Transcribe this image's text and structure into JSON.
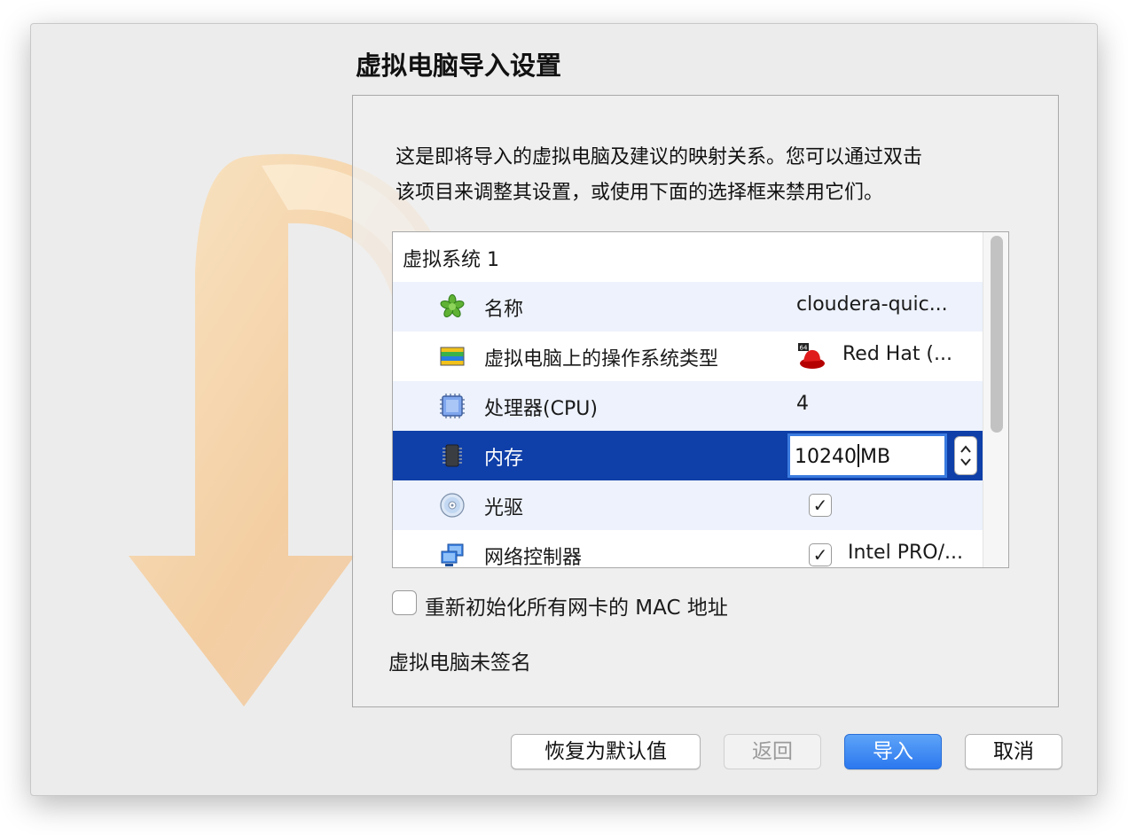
{
  "window": {
    "title": "虚拟电脑导入设置",
    "description_lines": [
      "这是即将导入的虚拟电脑及建议的映射关系。您可以通过双击",
      "该项目来调整其设置，或使用下面的选择框来禁用它们。"
    ]
  },
  "appliance": {
    "group_label": "虚拟系统 1",
    "rows": [
      {
        "icon": "name-asterisk-icon",
        "label": "名称",
        "value": "cloudera-quic..."
      },
      {
        "icon": "os-type-icon",
        "label": "虚拟电脑上的操作系统类型",
        "value": "Red Hat (...",
        "value_icon": "redhat-64-icon",
        "value_icon_text": "64"
      },
      {
        "icon": "cpu-icon",
        "label": "处理器(CPU)",
        "value": "4"
      },
      {
        "icon": "memory-chip-icon",
        "label": "内存",
        "value": "10240",
        "unit": "MB",
        "selected": true
      },
      {
        "icon": "optical-disc-icon",
        "label": "光驱",
        "checked": true,
        "check_mark": "✓"
      },
      {
        "icon": "network-icon",
        "label": "网络控制器",
        "checked": true,
        "check_mark": "✓",
        "value": "Intel PRO/..."
      }
    ]
  },
  "options": {
    "reinit_mac_label": "重新初始化所有网卡的 MAC 地址",
    "reinit_mac_checked": false
  },
  "status": {
    "signature_text": "虚拟电脑未签名"
  },
  "buttons": {
    "restore_defaults": "恢复为默认值",
    "back": "返回",
    "import": "导入",
    "cancel": "取消"
  },
  "colors": {
    "selection": "#0f3fa8",
    "alt_row": "#edf2fc",
    "primary_button": "#2b78ef",
    "focus_ring": "#3a7be0"
  }
}
